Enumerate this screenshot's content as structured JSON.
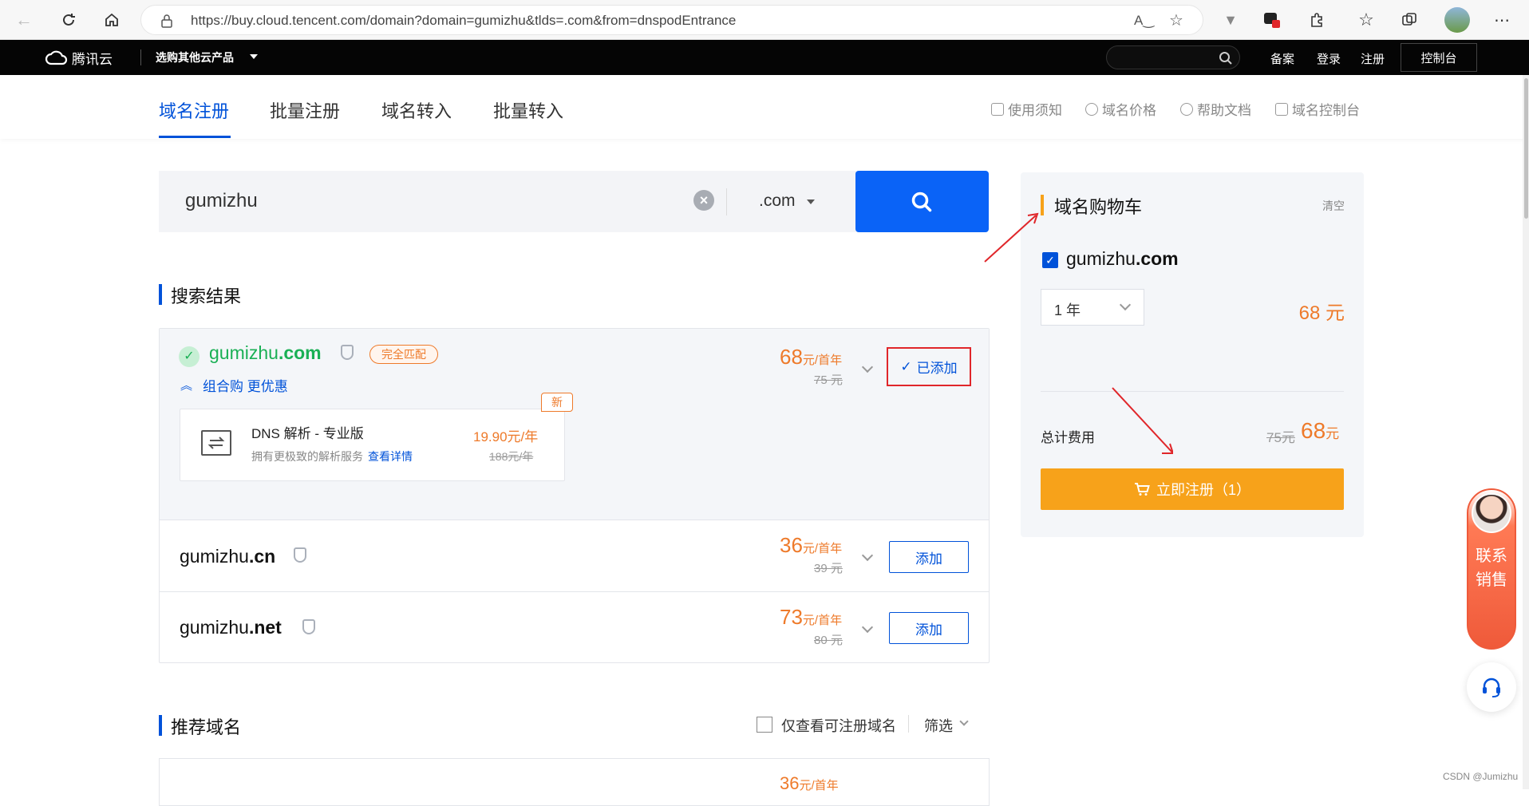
{
  "browser": {
    "url": "https://buy.cloud.tencent.com/domain?domain=gumizhu&tlds=.com&from=dnspodEntrance"
  },
  "topbar": {
    "logo_text": "腾讯云",
    "products_label": "选购其他云产品",
    "links": [
      "备案",
      "登录",
      "注册"
    ],
    "console_label": "控制台"
  },
  "tabs": [
    "域名注册",
    "批量注册",
    "域名转入",
    "批量转入"
  ],
  "help_links": [
    "使用须知",
    "域名价格",
    "帮助文档",
    "域名控制台"
  ],
  "search": {
    "value": "gumizhu",
    "tld": ".com"
  },
  "results": {
    "title": "搜索结果",
    "primary": {
      "name": "gumizhu",
      "tld": ".com",
      "badge": "完全匹配",
      "combo_label": "组合购 更优惠",
      "price": "68",
      "price_unit": "元/首年",
      "orig_price": "75 元",
      "added_label": "已添加"
    },
    "dns_addon": {
      "badge": "新",
      "title": "DNS 解析 - 专业版",
      "desc": "拥有更极致的解析服务",
      "link": "查看详情",
      "price": "19.90元/年",
      "orig_price": "188元/年"
    },
    "rows": [
      {
        "name": "gumizhu",
        "tld": ".cn",
        "price": "36",
        "price_unit": "元/首年",
        "orig_price": "39 元",
        "button": "添加"
      },
      {
        "name": "gumizhu",
        "tld": ".net",
        "price": "73",
        "price_unit": "元/首年",
        "orig_price": "80 元",
        "button": "添加"
      }
    ]
  },
  "recommend": {
    "title": "推荐域名",
    "filter_label": "仅查看可注册域名",
    "filter_button": "筛选",
    "first_price": "36",
    "first_price_unit": "元/首年"
  },
  "cart": {
    "title": "域名购物车",
    "clear": "清空",
    "domain_name": "gumizhu",
    "domain_tld": ".com",
    "period": "1 年",
    "item_price": "68 元",
    "total_label": "总计费用",
    "total_orig": "75元",
    "total_price": "68",
    "total_unit": "元",
    "register_label": "立即注册（1）"
  },
  "float": {
    "sales_label": "联系销售"
  },
  "watermark": "CSDN @Jumizhu",
  "colors": {
    "brand_blue": "#0052d9",
    "price_orange": "#ee7a2a",
    "cart_button": "#f7a21a",
    "highlight_red": "#e0262a",
    "success_green": "#1ab055"
  }
}
